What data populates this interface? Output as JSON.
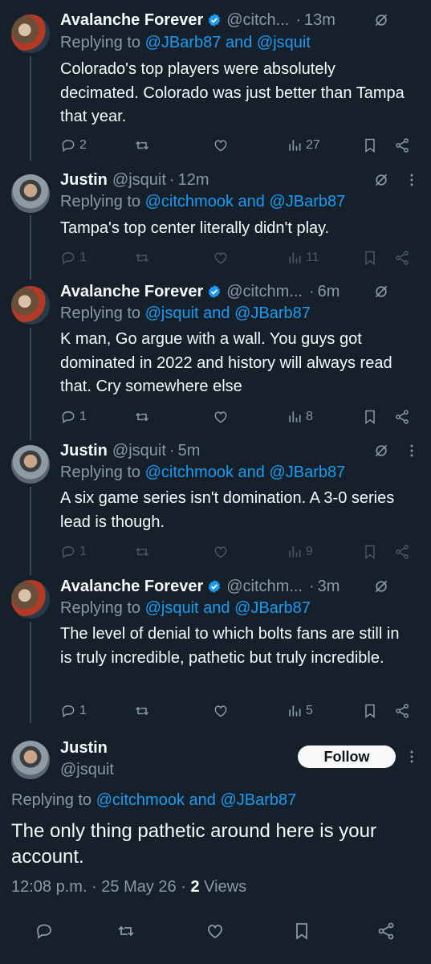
{
  "thread": [
    {
      "author": "Avalanche Forever",
      "verified": true,
      "handle": "@citch...",
      "time": "13m",
      "replying_prefix": "Replying to ",
      "replying_mentions": "@JBarb87 and @jsquit",
      "text": "Colorado's top players were absolutely decimated. Colorado was just better than Tampa that year.",
      "replies": "2",
      "views": "27"
    },
    {
      "author": "Justin",
      "verified": false,
      "handle": "@jsquit",
      "time": "12m",
      "replying_prefix": "Replying to ",
      "replying_mentions": "@citchmook and @JBarb87",
      "text": "Tampa's top center literally didn't play.",
      "replies": "1",
      "views": "11"
    },
    {
      "author": "Avalanche Forever",
      "verified": true,
      "handle": "@citchm...",
      "time": "6m",
      "replying_prefix": "Replying to ",
      "replying_mentions": "@jsquit and @JBarb87",
      "text": "K man, Go argue with a wall. You guys got dominated in 2022 and history will always read that. Cry somewhere else",
      "replies": "1",
      "views": "8"
    },
    {
      "author": "Justin",
      "verified": false,
      "handle": "@jsquit",
      "time": "5m",
      "replying_prefix": "Replying to ",
      "replying_mentions": "@citchmook and @JBarb87",
      "text": "A six game series isn't domination. A 3-0 series lead is though.",
      "replies": "1",
      "views": "9"
    },
    {
      "author": "Avalanche Forever",
      "verified": true,
      "handle": "@citchm...",
      "time": "3m",
      "replying_prefix": "Replying to ",
      "replying_mentions": "@jsquit and @JBarb87",
      "text": "The level of denial to which bolts fans are still in is truly incredible, pathetic but truly incredible.",
      "replies": "1",
      "views": "5"
    }
  ],
  "main": {
    "author": "Justin",
    "handle": "@jsquit",
    "follow_label": "Follow",
    "replying_prefix": "Replying to ",
    "replying_mentions": "@citchmook and @JBarb87",
    "text": "The only thing pathetic around here is your account.",
    "timestamp": "12:08 p.m. · 25 May 26 · ",
    "views_count": "2",
    "views_label": " Views"
  },
  "dot_sep": "·",
  "colors": {
    "background": "#15202b",
    "accent": "#1d9bf0",
    "secondary_text": "#8b98a5"
  }
}
